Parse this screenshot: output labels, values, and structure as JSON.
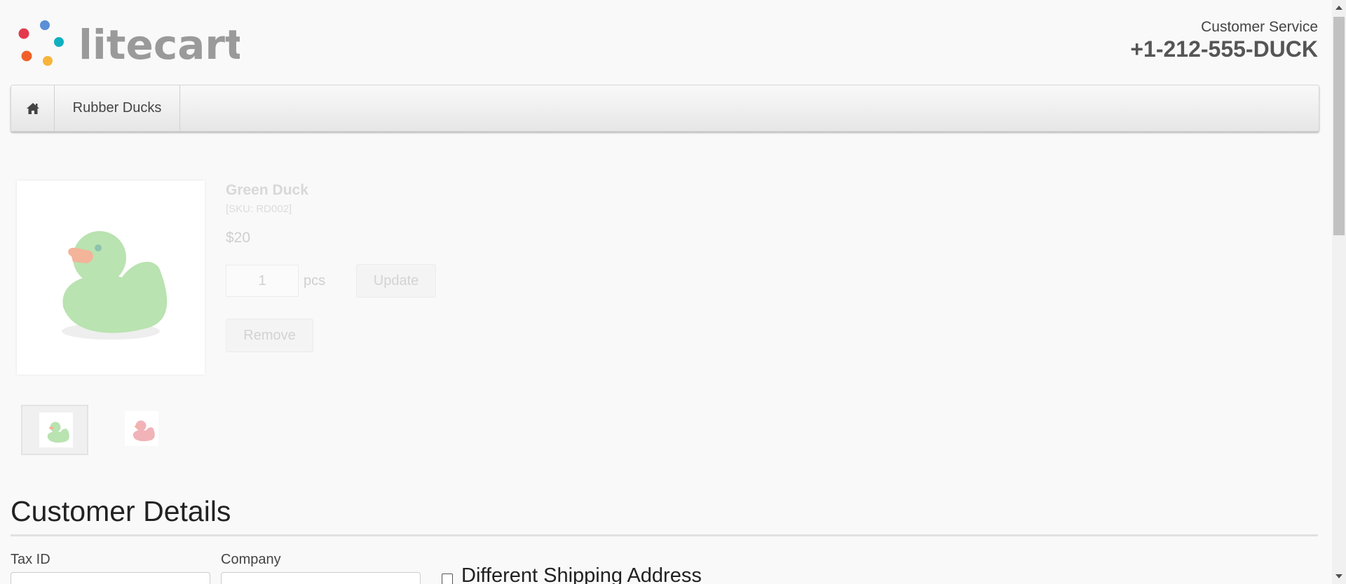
{
  "header": {
    "logo_text": "litecart",
    "customer_service_label": "Customer Service",
    "phone": "+1-212-555-DUCK"
  },
  "nav": {
    "home_icon": "home-icon",
    "items": [
      {
        "label": "Rubber Ducks"
      }
    ]
  },
  "product": {
    "name": "Green Duck",
    "sku": "[SKU: RD002]",
    "price": "$20",
    "quantity": "1",
    "unit": "pcs",
    "update_label": "Update",
    "remove_label": "Remove",
    "thumbnails": [
      {
        "color": "#b9e3b0",
        "selected": true
      },
      {
        "color": "#f1b3b8",
        "selected": false
      }
    ]
  },
  "customer_details": {
    "title": "Customer Details",
    "fields": [
      {
        "label": "Tax ID",
        "value": ""
      },
      {
        "label": "Company",
        "value": ""
      }
    ],
    "different_shipping_label": "Different Shipping Address",
    "different_shipping_checked": false
  },
  "colors": {
    "background": "#f9f9f9",
    "logo_text": "#9a9a9a",
    "duck_green": "#b9e3b0",
    "duck_red": "#f1b3b8",
    "beak": "#f3b49a"
  }
}
